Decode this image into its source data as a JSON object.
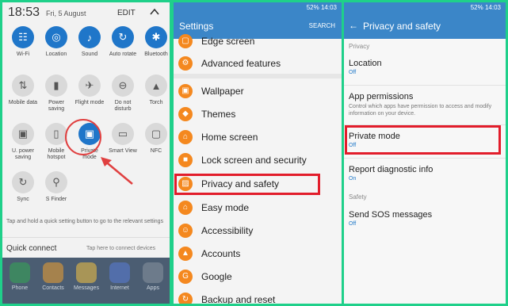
{
  "panel1": {
    "time": "18:53",
    "date": "Fri, 5 August",
    "edit_label": "EDIT",
    "tiles": [
      {
        "label": "Wi-Fi",
        "icon": "wifi-icon",
        "on": true
      },
      {
        "label": "Location",
        "icon": "location-icon",
        "on": true
      },
      {
        "label": "Sound",
        "icon": "sound-icon",
        "on": true
      },
      {
        "label": "Auto rotate",
        "icon": "auto-rotate-icon",
        "on": true
      },
      {
        "label": "Bluetooth",
        "icon": "bluetooth-icon",
        "on": true
      },
      {
        "label": "Mobile data",
        "icon": "mobile-data-icon",
        "on": false
      },
      {
        "label": "Power saving",
        "icon": "power-saving-icon",
        "on": false
      },
      {
        "label": "Flight mode",
        "icon": "flight-mode-icon",
        "on": false
      },
      {
        "label": "Do not disturb",
        "icon": "do-not-disturb-icon",
        "on": false
      },
      {
        "label": "Torch",
        "icon": "torch-icon",
        "on": false
      },
      {
        "label": "U. power saving",
        "icon": "ultra-power-saving-icon",
        "on": false
      },
      {
        "label": "Mobile hotspot",
        "icon": "mobile-hotspot-icon",
        "on": false
      },
      {
        "label": "Private mode",
        "icon": "private-mode-icon",
        "on": true
      },
      {
        "label": "Smart View",
        "icon": "smart-view-icon",
        "on": false
      },
      {
        "label": "NFC",
        "icon": "nfc-icon",
        "on": false
      },
      {
        "label": "Sync",
        "icon": "sync-icon",
        "on": false
      },
      {
        "label": "S Finder",
        "icon": "search-icon",
        "on": false
      }
    ],
    "hint": "Tap and hold a quick setting button to go to the relevant settings",
    "quick_connect": "Quick connect",
    "quick_connect_hint": "Tap here to connect devices",
    "dock": [
      {
        "label": "Phone",
        "color": "#35a853"
      },
      {
        "label": "Contacts",
        "color": "#f0a030"
      },
      {
        "label": "Messages",
        "color": "#f5c242"
      },
      {
        "label": "Internet",
        "color": "#5a7bd8"
      },
      {
        "label": "Apps",
        "color": "#8a93a0"
      }
    ]
  },
  "panel2": {
    "status": "52% 14:03",
    "title": "Settings",
    "search": "SEARCH",
    "items": [
      "Edge screen",
      "Advanced features",
      "Wallpaper",
      "Themes",
      "Home screen",
      "Lock screen and security",
      "Privacy and safety",
      "Easy mode",
      "Accessibility",
      "Accounts",
      "Google",
      "Backup and reset"
    ],
    "accent": "#3b86c8"
  },
  "panel3": {
    "status": "52% 14:03",
    "title": "Privacy and safety",
    "section_privacy": "Privacy",
    "location": {
      "title": "Location",
      "status": "Off"
    },
    "app_permissions": {
      "title": "App permissions",
      "desc": "Control which apps have permission to access and modify information on your device."
    },
    "private_mode": {
      "title": "Private mode",
      "status": "Off"
    },
    "report": {
      "title": "Report diagnostic info",
      "status": "On"
    },
    "section_safety": "Safety",
    "sos": {
      "title": "Send SOS messages",
      "status": "Off"
    }
  }
}
